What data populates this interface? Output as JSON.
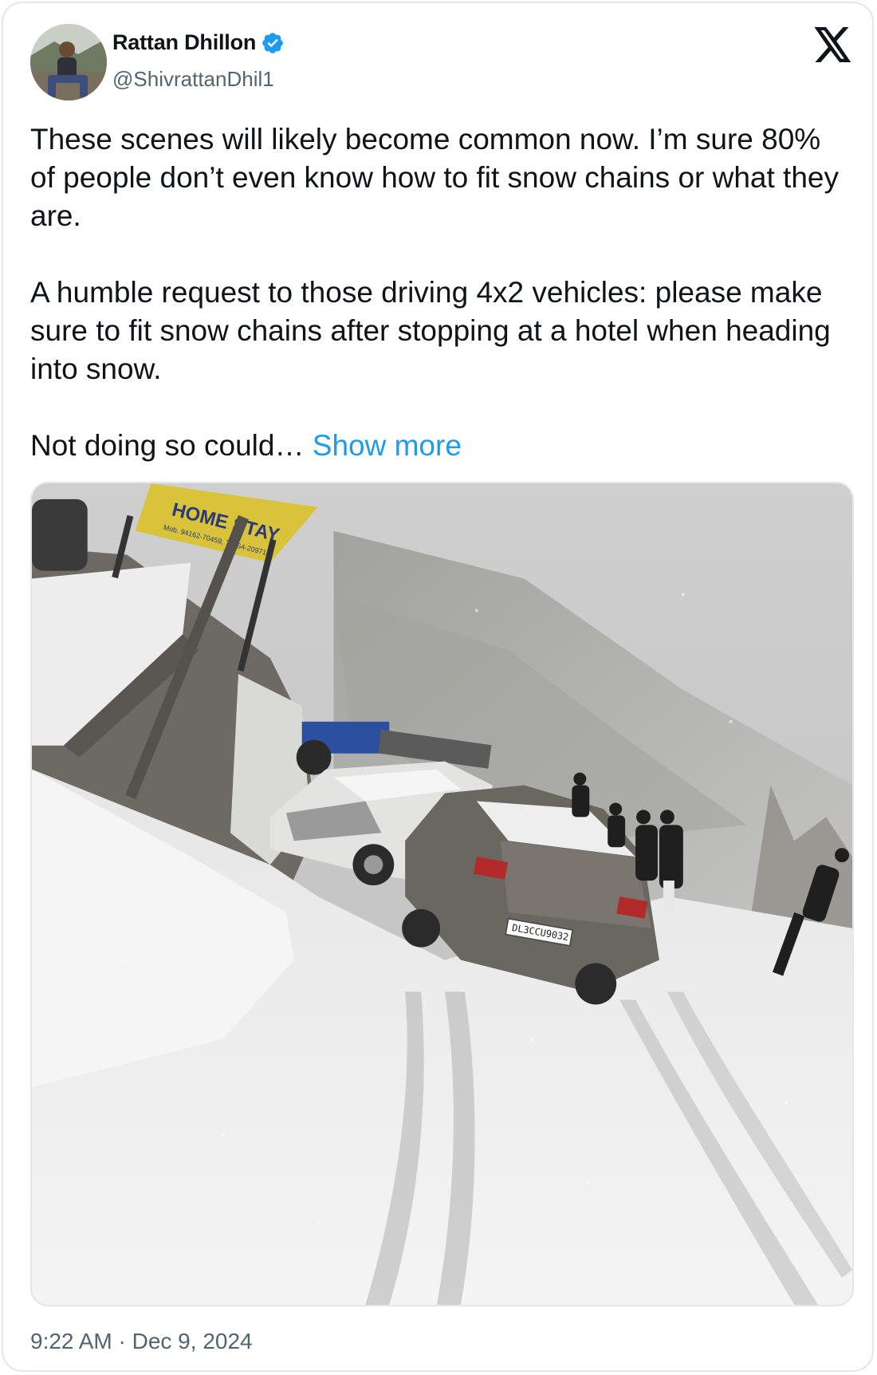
{
  "author": {
    "name": "Rattan Dhillon",
    "handle": "@ShivrattanDhil1",
    "verified": true
  },
  "platform_icon": "x-logo-icon",
  "tweet": {
    "paragraphs": [
      "These scenes will likely become common now. I’m sure 80% of people don’t even know how to fit snow chains or what they are.",
      "A humble request to those driving 4x2 vehicles: please make sure to fit snow chains after stopping at a hotel when heading into snow."
    ],
    "truncated_text": "Not doing so could…",
    "show_more_label": "Show more"
  },
  "media": {
    "sign_line1": "HOME STAY",
    "sign_line2": "Mob. 94162-70459, 78764-20971",
    "license_plate": "DL3CCU9032"
  },
  "timestamp": "9:22 AM · Dec 9, 2024",
  "colors": {
    "link": "#1d9bf0",
    "verified": "#1d9bf0",
    "text": "#0f1419",
    "secondary": "#536471",
    "border": "#e1e8ed"
  }
}
